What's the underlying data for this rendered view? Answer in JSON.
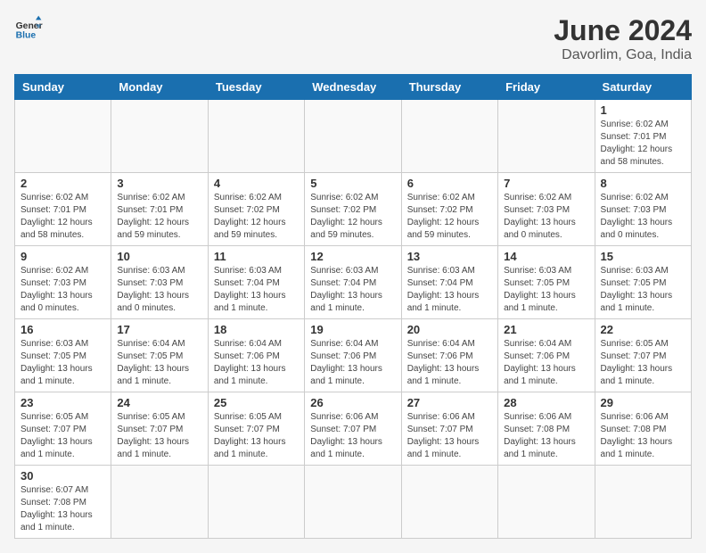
{
  "logo": {
    "text_general": "General",
    "text_blue": "Blue"
  },
  "title": "June 2024",
  "location": "Davorlim, Goa, India",
  "days_of_week": [
    "Sunday",
    "Monday",
    "Tuesday",
    "Wednesday",
    "Thursday",
    "Friday",
    "Saturday"
  ],
  "weeks": [
    [
      {
        "day": "",
        "info": ""
      },
      {
        "day": "",
        "info": ""
      },
      {
        "day": "",
        "info": ""
      },
      {
        "day": "",
        "info": ""
      },
      {
        "day": "",
        "info": ""
      },
      {
        "day": "",
        "info": ""
      },
      {
        "day": "1",
        "info": "Sunrise: 6:02 AM\nSunset: 7:01 PM\nDaylight: 12 hours and 58 minutes."
      }
    ],
    [
      {
        "day": "2",
        "info": "Sunrise: 6:02 AM\nSunset: 7:01 PM\nDaylight: 12 hours and 58 minutes."
      },
      {
        "day": "3",
        "info": "Sunrise: 6:02 AM\nSunset: 7:01 PM\nDaylight: 12 hours and 59 minutes."
      },
      {
        "day": "4",
        "info": "Sunrise: 6:02 AM\nSunset: 7:02 PM\nDaylight: 12 hours and 59 minutes."
      },
      {
        "day": "5",
        "info": "Sunrise: 6:02 AM\nSunset: 7:02 PM\nDaylight: 12 hours and 59 minutes."
      },
      {
        "day": "6",
        "info": "Sunrise: 6:02 AM\nSunset: 7:02 PM\nDaylight: 12 hours and 59 minutes."
      },
      {
        "day": "7",
        "info": "Sunrise: 6:02 AM\nSunset: 7:03 PM\nDaylight: 13 hours and 0 minutes."
      },
      {
        "day": "8",
        "info": "Sunrise: 6:02 AM\nSunset: 7:03 PM\nDaylight: 13 hours and 0 minutes."
      }
    ],
    [
      {
        "day": "9",
        "info": "Sunrise: 6:02 AM\nSunset: 7:03 PM\nDaylight: 13 hours and 0 minutes."
      },
      {
        "day": "10",
        "info": "Sunrise: 6:03 AM\nSunset: 7:03 PM\nDaylight: 13 hours and 0 minutes."
      },
      {
        "day": "11",
        "info": "Sunrise: 6:03 AM\nSunset: 7:04 PM\nDaylight: 13 hours and 1 minute."
      },
      {
        "day": "12",
        "info": "Sunrise: 6:03 AM\nSunset: 7:04 PM\nDaylight: 13 hours and 1 minute."
      },
      {
        "day": "13",
        "info": "Sunrise: 6:03 AM\nSunset: 7:04 PM\nDaylight: 13 hours and 1 minute."
      },
      {
        "day": "14",
        "info": "Sunrise: 6:03 AM\nSunset: 7:05 PM\nDaylight: 13 hours and 1 minute."
      },
      {
        "day": "15",
        "info": "Sunrise: 6:03 AM\nSunset: 7:05 PM\nDaylight: 13 hours and 1 minute."
      }
    ],
    [
      {
        "day": "16",
        "info": "Sunrise: 6:03 AM\nSunset: 7:05 PM\nDaylight: 13 hours and 1 minute."
      },
      {
        "day": "17",
        "info": "Sunrise: 6:04 AM\nSunset: 7:05 PM\nDaylight: 13 hours and 1 minute."
      },
      {
        "day": "18",
        "info": "Sunrise: 6:04 AM\nSunset: 7:06 PM\nDaylight: 13 hours and 1 minute."
      },
      {
        "day": "19",
        "info": "Sunrise: 6:04 AM\nSunset: 7:06 PM\nDaylight: 13 hours and 1 minute."
      },
      {
        "day": "20",
        "info": "Sunrise: 6:04 AM\nSunset: 7:06 PM\nDaylight: 13 hours and 1 minute."
      },
      {
        "day": "21",
        "info": "Sunrise: 6:04 AM\nSunset: 7:06 PM\nDaylight: 13 hours and 1 minute."
      },
      {
        "day": "22",
        "info": "Sunrise: 6:05 AM\nSunset: 7:07 PM\nDaylight: 13 hours and 1 minute."
      }
    ],
    [
      {
        "day": "23",
        "info": "Sunrise: 6:05 AM\nSunset: 7:07 PM\nDaylight: 13 hours and 1 minute."
      },
      {
        "day": "24",
        "info": "Sunrise: 6:05 AM\nSunset: 7:07 PM\nDaylight: 13 hours and 1 minute."
      },
      {
        "day": "25",
        "info": "Sunrise: 6:05 AM\nSunset: 7:07 PM\nDaylight: 13 hours and 1 minute."
      },
      {
        "day": "26",
        "info": "Sunrise: 6:06 AM\nSunset: 7:07 PM\nDaylight: 13 hours and 1 minute."
      },
      {
        "day": "27",
        "info": "Sunrise: 6:06 AM\nSunset: 7:07 PM\nDaylight: 13 hours and 1 minute."
      },
      {
        "day": "28",
        "info": "Sunrise: 6:06 AM\nSunset: 7:08 PM\nDaylight: 13 hours and 1 minute."
      },
      {
        "day": "29",
        "info": "Sunrise: 6:06 AM\nSunset: 7:08 PM\nDaylight: 13 hours and 1 minute."
      }
    ],
    [
      {
        "day": "30",
        "info": "Sunrise: 6:07 AM\nSunset: 7:08 PM\nDaylight: 13 hours and 1 minute."
      },
      {
        "day": "",
        "info": ""
      },
      {
        "day": "",
        "info": ""
      },
      {
        "day": "",
        "info": ""
      },
      {
        "day": "",
        "info": ""
      },
      {
        "day": "",
        "info": ""
      },
      {
        "day": "",
        "info": ""
      }
    ]
  ]
}
